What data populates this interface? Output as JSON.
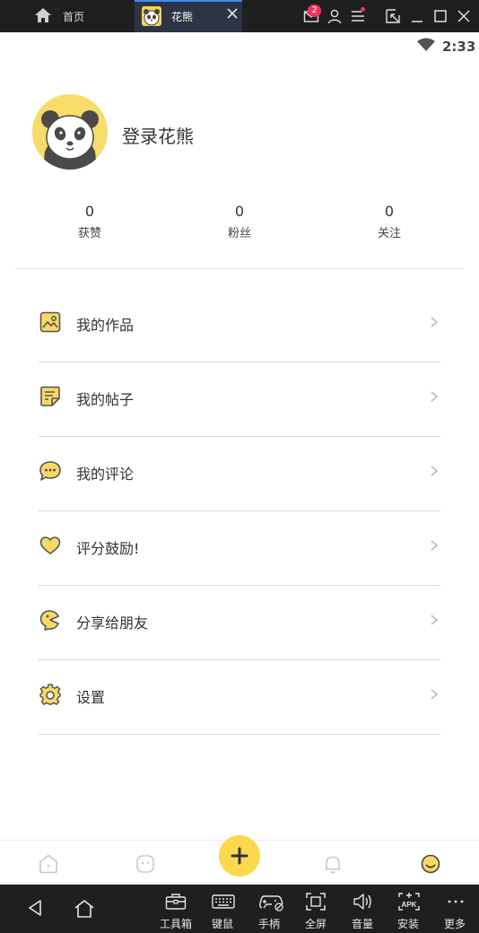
{
  "titlebar": {
    "home_tab_label": "首页",
    "app_tab_label": "花熊",
    "message_badge": "2"
  },
  "statusbar": {
    "time": "2:33"
  },
  "profile": {
    "login_text": "登录花熊",
    "stats": [
      {
        "value": "0",
        "label": "获赞"
      },
      {
        "value": "0",
        "label": "粉丝"
      },
      {
        "value": "0",
        "label": "关注"
      }
    ]
  },
  "menu": {
    "items": [
      {
        "label": "我的作品",
        "icon": "picture-icon"
      },
      {
        "label": "我的帖子",
        "icon": "note-icon"
      },
      {
        "label": "我的评论",
        "icon": "comment-icon"
      },
      {
        "label": "评分鼓励!",
        "icon": "heart-icon"
      },
      {
        "label": "分享给朋友",
        "icon": "share-icon"
      },
      {
        "label": "设置",
        "icon": "gear-icon"
      }
    ]
  },
  "bottom_nav": {
    "items": [
      "home-icon",
      "discover-icon",
      "add-icon",
      "bell-icon",
      "profile-icon"
    ]
  },
  "toolbar": {
    "tools": [
      {
        "label": "工具箱",
        "icon": "toolbox-icon"
      },
      {
        "label": "键鼠",
        "icon": "keyboard-icon"
      },
      {
        "label": "手柄",
        "icon": "gamepad-icon"
      },
      {
        "label": "全屏",
        "icon": "fullscreen-icon"
      },
      {
        "label": "音量",
        "icon": "volume-icon"
      },
      {
        "label": "安装",
        "icon": "apk-icon"
      },
      {
        "label": "更多",
        "icon": "more-icon"
      }
    ]
  },
  "colors": {
    "accent_yellow": "#fbd84d",
    "icon_yellow": "#f8d866",
    "emulator_bar": "#1f1f22",
    "badge_red": "#f2325a"
  }
}
